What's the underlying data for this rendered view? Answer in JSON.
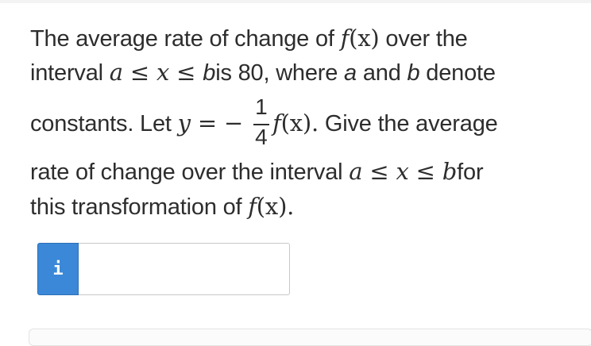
{
  "question": {
    "line1": {
      "t1": "The average rate of change of ",
      "f": "f",
      "arg": "(x)",
      "t2": " over the"
    },
    "line2": {
      "t1": "interval ",
      "a": "a",
      "le1": " ≤ ",
      "x": "x",
      "le2": " ≤ ",
      "b": "b",
      "t2": "is 80, where ",
      "a2": "a",
      "t3": " and ",
      "b2": "b",
      "t4": " denote"
    },
    "line3": {
      "t1": "constants. Let ",
      "y": "y",
      "eq": " = ",
      "minus": " − ",
      "num": "1",
      "den": "4",
      "f": "f",
      "arg": "(x).",
      "t2": " Give the average"
    },
    "line4": {
      "t1": "rate of change over the interval ",
      "a": "a",
      "le1": " ≤ ",
      "x": "x",
      "le2": " ≤ ",
      "b": "b",
      "t2": "for"
    },
    "line5": {
      "t1": "this transformation of ",
      "f": "f",
      "arg": "(x)."
    }
  },
  "answer": {
    "info_label": "i",
    "value": "",
    "placeholder": ""
  }
}
